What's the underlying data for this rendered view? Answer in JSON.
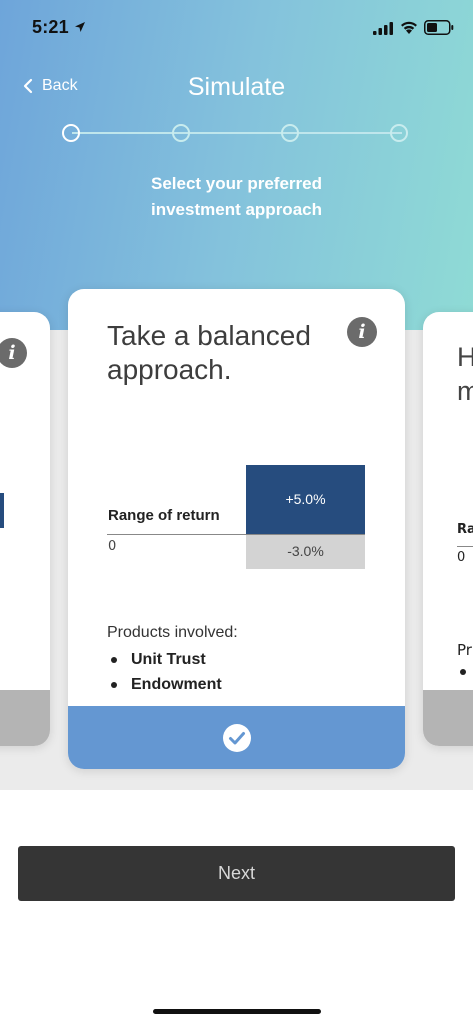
{
  "status_bar": {
    "time": "5:21"
  },
  "nav": {
    "back_label": "Back",
    "title": "Simulate"
  },
  "stepper": {
    "total_steps": 4,
    "current_step": 1
  },
  "subtitle": {
    "line1": "Select your preferred",
    "line2": "investment approach"
  },
  "cards": {
    "left": {
      "info_icon_label": "i"
    },
    "main": {
      "title_line1": "Take a balanced",
      "title_line2": "approach.",
      "info_icon_label": "i",
      "range_label": "Range of return",
      "zero_label": "0",
      "positive_return": "+5.0%",
      "negative_return": "-3.0%",
      "products_label": "Products involved:",
      "products": [
        "Unit Trust",
        "Endowment"
      ],
      "selected": true
    },
    "right": {
      "title_line1": "H",
      "title_line2": "m",
      "range_label_fragment": "Ra",
      "zero_label": "0",
      "products_label_fragment": "Pr"
    }
  },
  "next_button": {
    "label": "Next"
  },
  "colors": {
    "header_gradient_start": "#6ea5da",
    "header_gradient_end": "#8fdbd5",
    "selected_footer": "#6497d2",
    "positive_bar": "#264c7e",
    "negative_bar": "#d3d3d3",
    "next_button_bg": "#353535"
  }
}
